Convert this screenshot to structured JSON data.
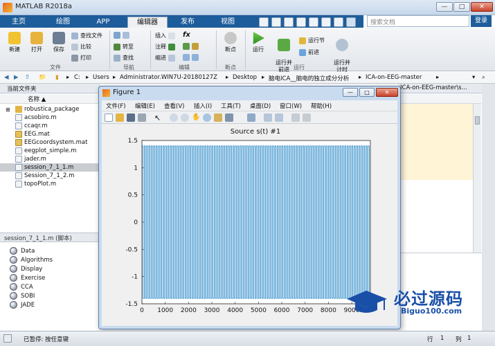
{
  "app": {
    "title": "MATLAB R2018a"
  },
  "toolbar_right": {
    "search_placeholder": "搜索文档",
    "login_label": "登录"
  },
  "tabs": [
    {
      "label": "主页",
      "active": false
    },
    {
      "label": "绘图",
      "active": false
    },
    {
      "label": "APP",
      "active": false
    },
    {
      "label": "编辑器",
      "active": true
    },
    {
      "label": "发布",
      "active": false
    },
    {
      "label": "视图",
      "active": false
    }
  ],
  "ribbon": {
    "file": {
      "new": "新建",
      "open": "打开",
      "save": "保存",
      "find_files": "查找文件",
      "compare": "比较",
      "print": "打印",
      "group": "文件"
    },
    "navigate": {
      "goto": "转至",
      "find": "查找",
      "group": "导航"
    },
    "edit": {
      "insert": "插入",
      "comment": "注释",
      "indent": "缩进",
      "fx": "fx",
      "group": "编辑"
    },
    "breakpoints": {
      "label": "断点",
      "group": "断点"
    },
    "run": {
      "run": "运行",
      "run_advance": "运行并\n前进",
      "run_section": "运行节",
      "advance": "前进",
      "run_time": "运行并\n计时",
      "group": "运行"
    }
  },
  "address": {
    "segments": [
      "C:",
      "Users",
      "Administrator.WIN7U-20180127Z",
      "Desktop",
      "脑电ICA__脑电的独立成分分析",
      "ICA-on-EEG-master"
    ]
  },
  "current_folder": {
    "title": "当前文件夹",
    "column": "名称 ▲",
    "files": [
      {
        "name": "robustica_package",
        "type": "folder",
        "selected": false
      },
      {
        "name": "acsobiro.m",
        "type": "m",
        "selected": false
      },
      {
        "name": "ccaqr.m",
        "type": "m",
        "selected": false
      },
      {
        "name": "EEG.mat",
        "type": "mat",
        "selected": false
      },
      {
        "name": "EEGcoordsystem.mat",
        "type": "mat",
        "selected": false
      },
      {
        "name": "eegplot_simple.m",
        "type": "m",
        "selected": false
      },
      {
        "name": "jader.m",
        "type": "m",
        "selected": false
      },
      {
        "name": "session_7_1_1.m",
        "type": "m",
        "selected": true
      },
      {
        "name": "Session_7_1_2.m",
        "type": "m",
        "selected": false
      },
      {
        "name": "topoPlot.m",
        "type": "m",
        "selected": false
      }
    ]
  },
  "details": {
    "title": "session_7_1_1.m  (脚本)",
    "items": [
      "Data",
      "Algorithms",
      "Display",
      "Exercise",
      "CCA",
      "SOBI",
      "JADE"
    ]
  },
  "editor": {
    "path": "ICA-on-EEG-master\\s..."
  },
  "status": {
    "left": "已暂停: 按任意键",
    "row_label": "行",
    "row_value": "1",
    "col_label": "列",
    "col_value": "1"
  },
  "figure": {
    "title": "Figure 1",
    "menu": [
      "文件(F)",
      "编辑(E)",
      "查看(V)",
      "插入(I)",
      "工具(T)",
      "桌面(D)",
      "窗口(W)",
      "帮助(H)"
    ],
    "win_buttons": [
      "—",
      "□",
      "✕"
    ]
  },
  "chart_data": {
    "type": "line",
    "title": "Source s(t) #1",
    "xlabel": "",
    "ylabel": "",
    "xlim": [
      0,
      9800
    ],
    "ylim": [
      -1.5,
      1.5
    ],
    "xticks": [
      0,
      1000,
      2000,
      3000,
      4000,
      5000,
      6000,
      7000,
      8000,
      9000
    ],
    "yticks": [
      -1.5,
      -1,
      -0.5,
      0,
      0.5,
      1,
      1.5
    ],
    "grid": false,
    "series": [
      {
        "waveform": "square",
        "cycles": 98,
        "amplitude_high": 1.4,
        "amplitude_low": -1.4,
        "x_end": 9800,
        "color": "#0072bd"
      }
    ]
  },
  "watermark": {
    "big": "必过源码",
    "small": "Biguo100.com"
  },
  "colors": {
    "tab_bar": "#1e5d9b",
    "line": "#0072bd",
    "accent": "#e86a1a"
  }
}
